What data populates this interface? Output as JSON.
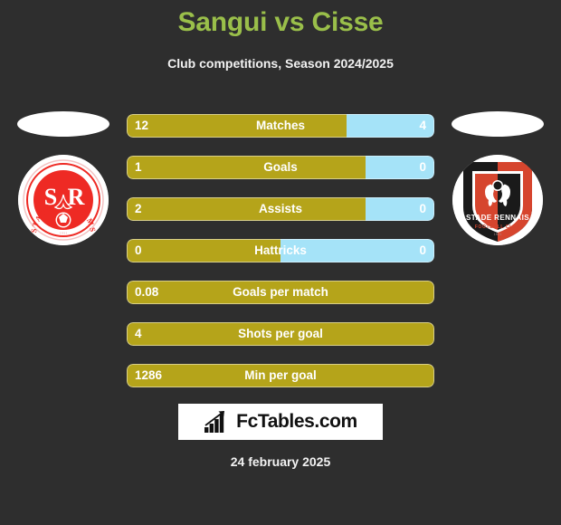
{
  "header": {
    "title": "Sangui vs Cisse",
    "subtitle": "Club competitions, Season 2024/2025",
    "title_color": "#9ABF4A"
  },
  "teams": {
    "home": {
      "crest_name": "stade-de-reims-crest",
      "crest_text_top": "STADE DE REIMS",
      "crest_monogram": "S R"
    },
    "away": {
      "crest_name": "stade-rennais-crest",
      "crest_text_top": "STADE RENNAIS",
      "crest_text_sub": "FOOTBALL CLUB"
    }
  },
  "colors": {
    "background": "#2e2e2e",
    "home_bar": "#B5A41A",
    "away_bar": "#A5E3F8",
    "text": "#ffffff"
  },
  "stats": [
    {
      "label": "Matches",
      "home": "12",
      "away": "4",
      "home_pct": 71.5,
      "away_pct": 28.5,
      "split": true
    },
    {
      "label": "Goals",
      "home": "1",
      "away": "0",
      "home_pct": 77.5,
      "away_pct": 22.5,
      "split": true
    },
    {
      "label": "Assists",
      "home": "2",
      "away": "0",
      "home_pct": 77.5,
      "away_pct": 22.5,
      "split": true
    },
    {
      "label": "Hattricks",
      "home": "0",
      "away": "0",
      "home_pct": 50,
      "away_pct": 50,
      "split": true
    },
    {
      "label": "Goals per match",
      "home": "0.08",
      "away": "",
      "home_pct": 100,
      "away_pct": 0,
      "split": false
    },
    {
      "label": "Shots per goal",
      "home": "4",
      "away": "",
      "home_pct": 100,
      "away_pct": 0,
      "split": false
    },
    {
      "label": "Min per goal",
      "home": "1286",
      "away": "",
      "home_pct": 100,
      "away_pct": 0,
      "split": false
    }
  ],
  "footer": {
    "logo_text": "FcTables.com",
    "logo_icon": "bar-chart-growth-icon",
    "date": "24 february 2025"
  }
}
